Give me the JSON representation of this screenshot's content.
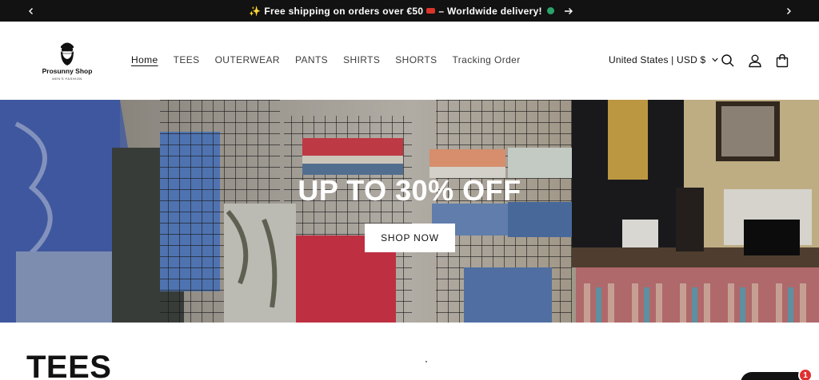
{
  "announcement": {
    "text_part1": "Free shipping on orders over €50",
    "text_part2": "– Worldwide delivery!"
  },
  "logo": {
    "name": "Prosunny Shop",
    "tagline": "MEN'S FASHION"
  },
  "nav": {
    "items": [
      {
        "label": "Home",
        "active": true
      },
      {
        "label": "TEES"
      },
      {
        "label": "OUTERWEAR"
      },
      {
        "label": "PANTS"
      },
      {
        "label": "SHIRTS"
      },
      {
        "label": "SHORTS"
      },
      {
        "label": "Tracking Order"
      }
    ]
  },
  "header": {
    "country_selector": "United States | USD $",
    "icons": [
      "search-icon",
      "account-icon",
      "cart-icon"
    ]
  },
  "hero": {
    "title": "UP TO 30% OFF",
    "button_label": "SHOP NOW"
  },
  "section": {
    "title": "TEES"
  },
  "chat": {
    "badge_count": "1"
  },
  "colors": {
    "announcement_bg": "#121212",
    "text": "#121212",
    "hero_button_bg": "#ffffff",
    "badge": "#e03131"
  }
}
